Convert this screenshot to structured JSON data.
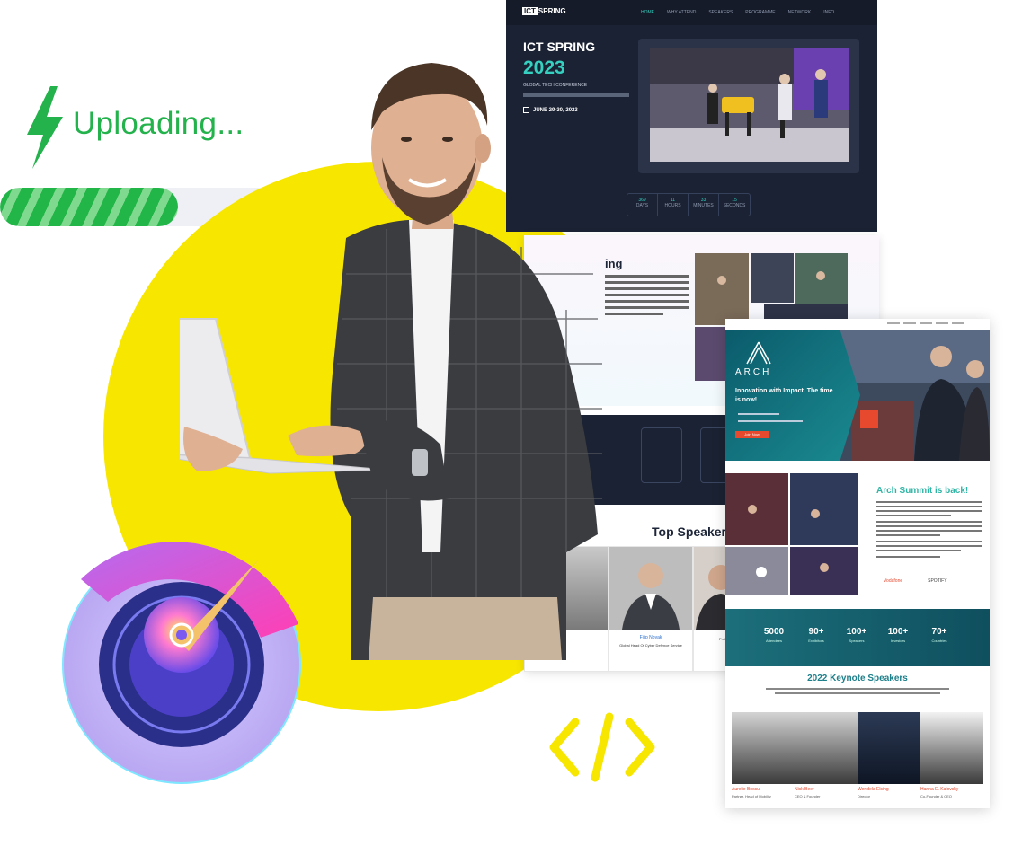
{
  "upload": {
    "label": "Uploading...",
    "progress": 0.58
  },
  "ict": {
    "logo_box": "ICT",
    "logo_text": "SPRING",
    "menu": [
      "HOME",
      "WHY ATTEND",
      "SPEAKERS",
      "PROGRAMME",
      "NETWORK",
      "INFO"
    ],
    "title": "ICT SPRING",
    "year": "2023",
    "subtitle": "GLOBAL TECH CONFERENCE",
    "date": "JUNE 29-30, 2023",
    "countdown": [
      {
        "value": "369",
        "label": "DAYS"
      },
      {
        "value": "11",
        "label": "HOURS"
      },
      {
        "value": "33",
        "label": "MINUTES"
      },
      {
        "value": "15",
        "label": "SECONDS"
      }
    ]
  },
  "mid": {
    "heading": "ing",
    "speakers_title": "Top Speaker",
    "speakers": [
      {
        "name": "",
        "role": ""
      },
      {
        "name": "Filip Novak",
        "role": "Global Head Of Cyber Defence Service"
      },
      {
        "name": "",
        "role": "Professor & Director"
      }
    ]
  },
  "arch": {
    "logo": "ARCH",
    "tagline": "Innovation with Impact. The time is now!",
    "button": "Join Now",
    "back_title": "Arch Summit is back!",
    "logos": [
      "Vodafone",
      "",
      "SPOTIFY"
    ],
    "stats": [
      {
        "value": "5000",
        "label": "Attendees"
      },
      {
        "value": "90+",
        "label": "Exhibitors"
      },
      {
        "value": "100+",
        "label": "Speakers"
      },
      {
        "value": "100+",
        "label": "Investors"
      },
      {
        "value": "70+",
        "label": "Countries"
      }
    ],
    "keynote_title": "2022 Keynote Speakers",
    "keynote_speakers": [
      {
        "name": "Aurelie Bossu",
        "role": "Partner, Head of Mobility"
      },
      {
        "name": "Nick Beer",
        "role": "CEO & Founder"
      },
      {
        "name": "Wendela Elsing",
        "role": "Director"
      },
      {
        "name": "Hanna E. Kalovsky",
        "role": "Co-Founder & CEO"
      }
    ]
  },
  "colors": {
    "yellow": "#f7e600",
    "green": "#23b24b",
    "teal": "#35d0c0",
    "orange": "#e6492e"
  }
}
